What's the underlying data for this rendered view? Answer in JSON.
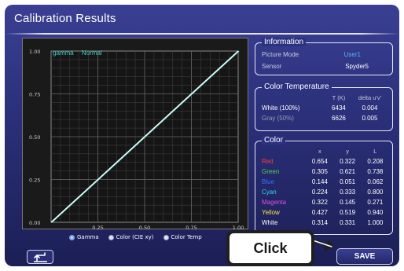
{
  "title": "Calibration Results",
  "chart": {
    "legend_gamma": "gamma",
    "legend_mode": "Normal",
    "y_ticks": [
      "1.00",
      "0.75",
      "0.50",
      "0.25",
      "0.00"
    ],
    "x_ticks": [
      "0.25",
      "0.50",
      "0.75",
      "1.00"
    ]
  },
  "chart_data": {
    "type": "line",
    "title": "",
    "xlabel": "",
    "ylabel": "",
    "xlim": [
      0,
      1
    ],
    "ylim": [
      0,
      1
    ],
    "grid": true,
    "series": [
      {
        "name": "gamma",
        "x": [
          0,
          1
        ],
        "y": [
          0,
          1
        ],
        "color": "#3fd0c8"
      },
      {
        "name": "Normal",
        "x": [
          0,
          1
        ],
        "y": [
          0,
          1
        ],
        "color": "#ffffff"
      }
    ]
  },
  "radios": [
    {
      "label": "Gamma",
      "selected": true
    },
    {
      "label": "Color (CIE xy)",
      "selected": false
    },
    {
      "label": "Color Temp",
      "selected": false
    }
  ],
  "information": {
    "title": "Information",
    "picture_mode_label": "Picture Mode",
    "picture_mode_value": "User1",
    "sensor_label": "Sensor",
    "sensor_value": "Spyder5"
  },
  "color_temperature": {
    "title": "Color Temperature",
    "headers": [
      "",
      "T (K)",
      "delta u'v'"
    ],
    "rows": [
      {
        "name": "White (100%)",
        "t": "6434",
        "delta": "0.004",
        "color": "#ffffff"
      },
      {
        "name": "Gray (50%)",
        "t": "6626",
        "delta": "0.005",
        "color": "#9a9cb0"
      }
    ]
  },
  "color": {
    "title": "Color",
    "headers": [
      "",
      "x",
      "y",
      "L"
    ],
    "rows": [
      {
        "name": "Red",
        "x": "0.654",
        "y": "0.322",
        "L": "0.208",
        "color": "#ff3b3b"
      },
      {
        "name": "Green",
        "x": "0.305",
        "y": "0.621",
        "L": "0.738",
        "color": "#4cd94c"
      },
      {
        "name": "Blue",
        "x": "0.144",
        "y": "0.051",
        "L": "0.062",
        "color": "#3a6bff"
      },
      {
        "name": "Cyan",
        "x": "0.224",
        "y": "0.333",
        "L": "0.800",
        "color": "#39d6ea"
      },
      {
        "name": "Magenta",
        "x": "0.322",
        "y": "0.145",
        "L": "0.271",
        "color": "#e04fe0"
      },
      {
        "name": "Yellow",
        "x": "0.427",
        "y": "0.519",
        "L": "0.940",
        "color": "#f1e24a"
      },
      {
        "name": "White",
        "x": "0.314",
        "y": "0.331",
        "L": "1.000",
        "color": "#ffffff"
      }
    ]
  },
  "buttons": {
    "back_icon": "return-arrow-icon",
    "save_label": "SAVE"
  },
  "callout": {
    "label": "Click"
  }
}
